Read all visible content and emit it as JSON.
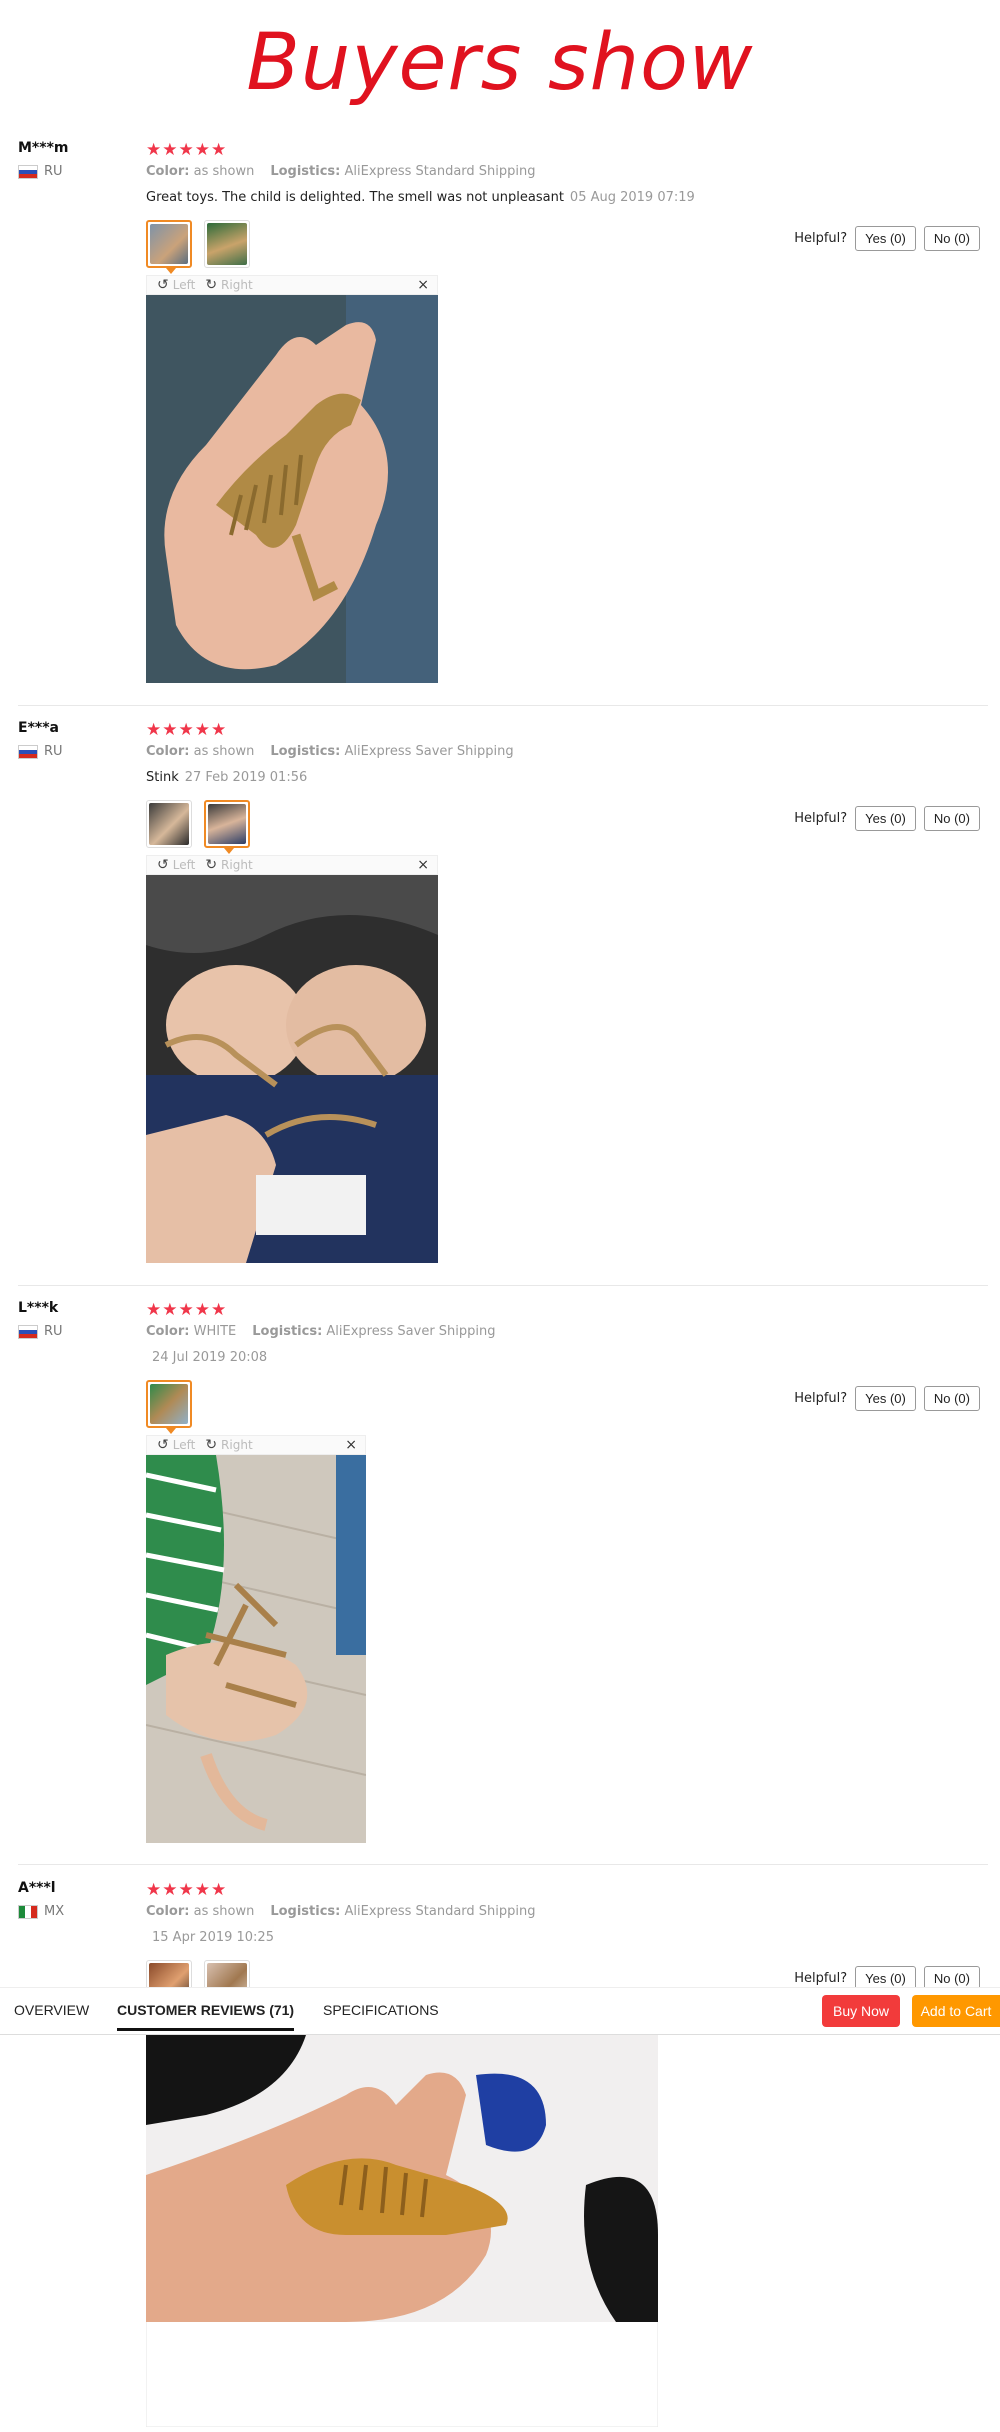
{
  "banner": {
    "title": "Buyers show"
  },
  "labels": {
    "color": "Color:",
    "logistics": "Logistics:",
    "helpful": "Helpful?",
    "rotate_left": "Left",
    "rotate_right": "Right",
    "close": "×"
  },
  "reviews": [
    {
      "name": "M***m",
      "country": "RU",
      "stars": "★★★★★",
      "color": "as shown",
      "logistics": "AliExpress Standard Shipping",
      "text": "Great toys. The child is delighted. The smell was not unpleasant",
      "date": "05 Aug 2019 07:19",
      "yes": "Yes (0)",
      "no": "No (0)"
    },
    {
      "name": "E***a",
      "country": "RU",
      "stars": "★★★★★",
      "color": "as shown",
      "logistics": "AliExpress Saver Shipping",
      "text": "Stink",
      "date": "27 Feb 2019 01:56",
      "yes": "Yes (0)",
      "no": "No (0)"
    },
    {
      "name": "L***k",
      "country": "RU",
      "stars": "★★★★★",
      "color": "WHITE",
      "logistics": "AliExpress Saver Shipping",
      "text": "",
      "date": "24 Jul 2019 20:08",
      "yes": "Yes (0)",
      "no": "No (0)"
    },
    {
      "name": "A***l",
      "country": "MX",
      "stars": "★★★★★",
      "color": "as shown",
      "logistics": "AliExpress Standard Shipping",
      "text": "",
      "date": "15 Apr 2019 10:25",
      "yes": "Yes (0)",
      "no": "No (0)"
    }
  ],
  "tabs": {
    "overview": "OVERVIEW",
    "reviews": "CUSTOMER REVIEWS (71)",
    "specs": "SPECIFICATIONS",
    "buy_now": "Buy Now",
    "add_to_cart": "Add to Cart"
  },
  "colors": {
    "star": "#f0364a",
    "buy": "#f23b3b",
    "cart": "#ff9800",
    "banner": "#e0121f"
  }
}
